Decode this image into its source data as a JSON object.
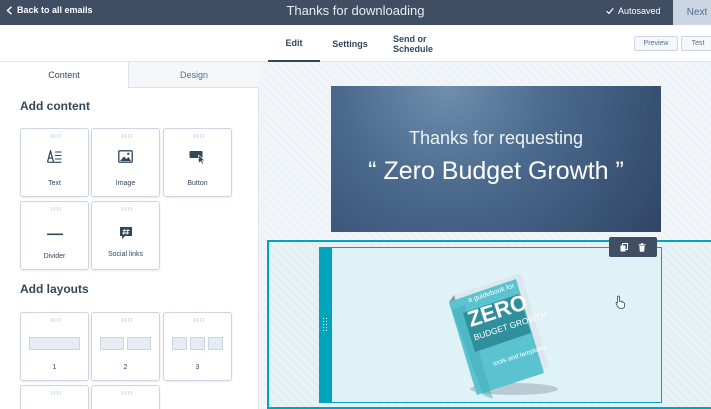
{
  "topbar": {
    "back_label": "Back to all emails",
    "title": "Thanks for downloading",
    "autosave_status": "Autosaved",
    "next_label": "Next"
  },
  "subnav": {
    "tabs": [
      "Edit",
      "Settings",
      "Send or Schedule"
    ],
    "active_tab": "Edit",
    "preview_label": "Preview",
    "test_label": "Test"
  },
  "panel": {
    "tabs": [
      "Content",
      "Design"
    ],
    "active_tab": "Content",
    "add_content_title": "Add content",
    "content_items": [
      "Text",
      "Image",
      "Button",
      "Divider",
      "Social links"
    ],
    "add_layouts_title": "Add layouts",
    "layout_items": [
      "1",
      "2",
      "3"
    ]
  },
  "canvas": {
    "hero_line1": "Thanks for requesting",
    "hero_line2": "“ Zero Budget Growth ”",
    "book": {
      "tagline": "a guidebook for",
      "title": "ZERO",
      "subtitle": "BUDGET GROWTH",
      "footer": "tools and templates"
    }
  },
  "colors": {
    "topbar_bg": "#3f4e63",
    "accent": "#00a4bd",
    "hero_bg": "#3e5a7e",
    "book_cover": "#5bc3cf"
  }
}
